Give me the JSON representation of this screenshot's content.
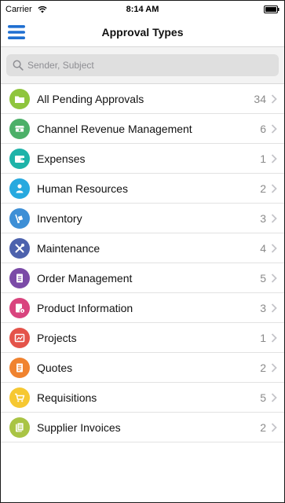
{
  "status_bar": {
    "carrier": "Carrier",
    "time": "8:14 AM"
  },
  "header": {
    "title": "Approval Types",
    "menu_icon": "hamburger-menu-icon"
  },
  "search": {
    "placeholder": "Sender, Subject",
    "icon": "search-icon"
  },
  "list": [
    {
      "label": "All Pending Approvals",
      "count": "34",
      "icon": "folder-icon",
      "color": "#8fc53d"
    },
    {
      "label": "Channel Revenue Management",
      "count": "6",
      "icon": "money-icon",
      "color": "#4cb068"
    },
    {
      "label": "Expenses",
      "count": "1",
      "icon": "wallet-icon",
      "color": "#1fb3a9"
    },
    {
      "label": "Human Resources",
      "count": "2",
      "icon": "person-icon",
      "color": "#27a9df"
    },
    {
      "label": "Inventory",
      "count": "3",
      "icon": "dolly-icon",
      "color": "#3d8fd6"
    },
    {
      "label": "Maintenance",
      "count": "4",
      "icon": "tools-icon",
      "color": "#4d62ad"
    },
    {
      "label": "Order Management",
      "count": "5",
      "icon": "document-icon",
      "color": "#7b4aa7"
    },
    {
      "label": "Product Information",
      "count": "3",
      "icon": "product-info-icon",
      "color": "#d9447e"
    },
    {
      "label": "Projects",
      "count": "1",
      "icon": "project-icon",
      "color": "#e4534a"
    },
    {
      "label": "Quotes",
      "count": "2",
      "icon": "quote-icon",
      "color": "#f0832f"
    },
    {
      "label": "Requisitions",
      "count": "5",
      "icon": "cart-icon",
      "color": "#f6c832"
    },
    {
      "label": "Supplier Invoices",
      "count": "2",
      "icon": "invoice-icon",
      "color": "#a9c444"
    }
  ]
}
